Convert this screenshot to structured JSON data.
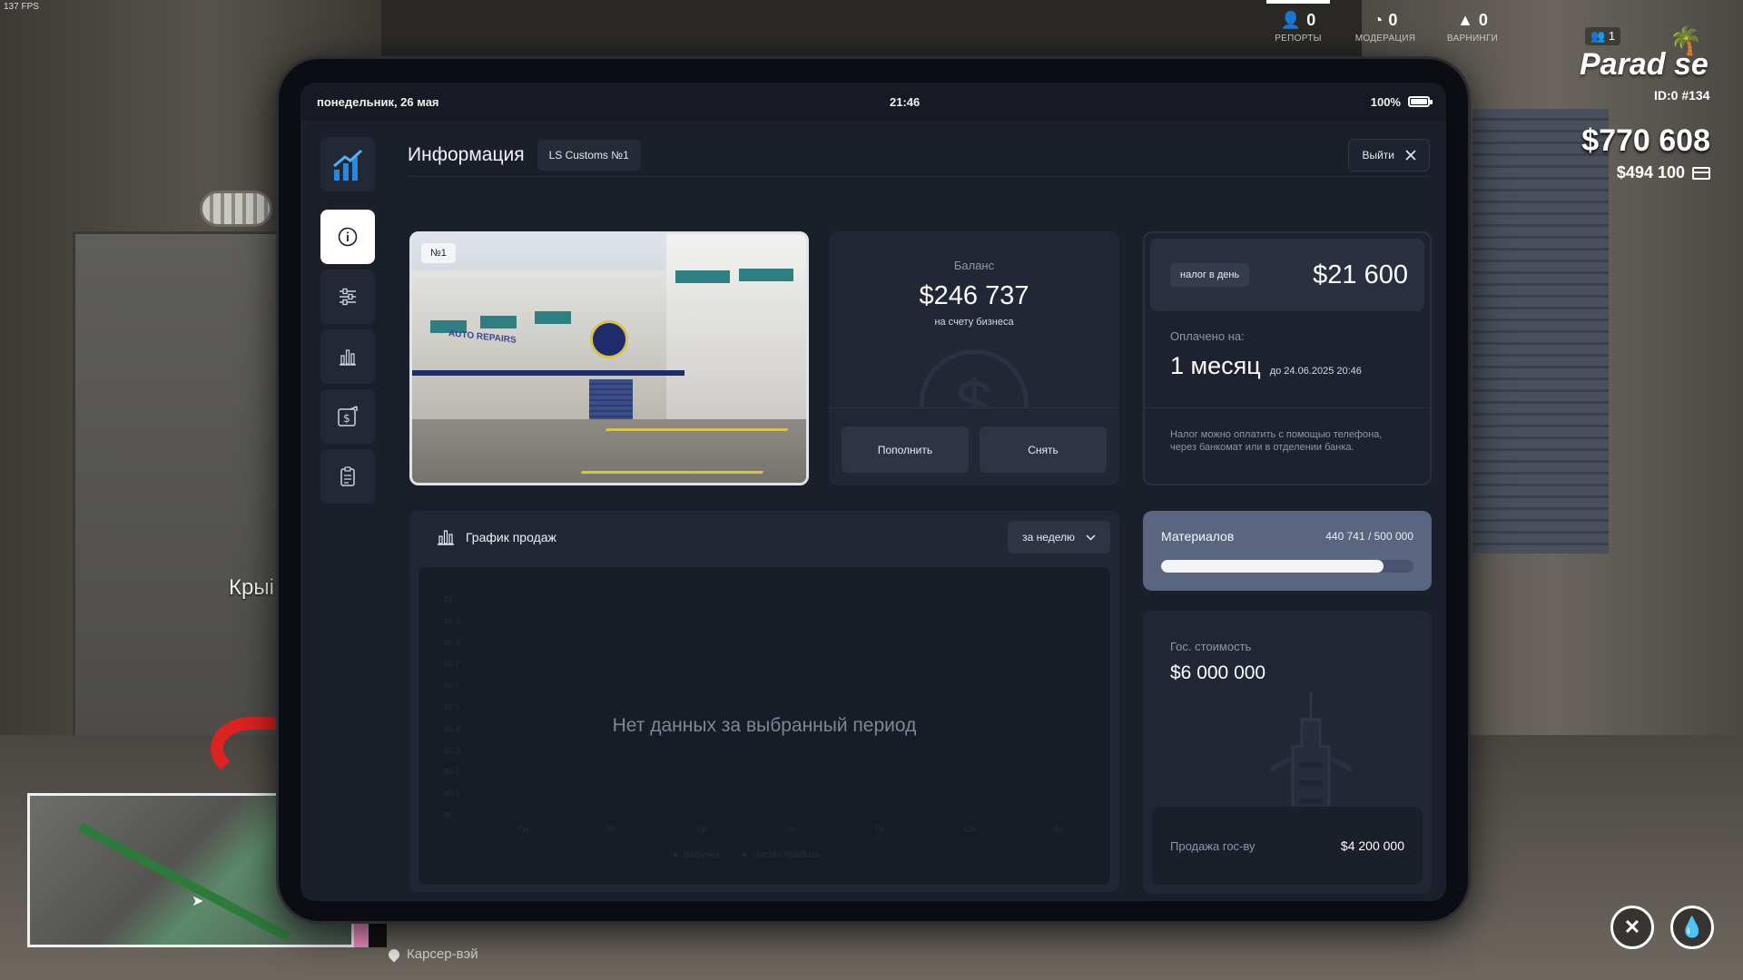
{
  "hud": {
    "fps": "137 FPS",
    "reports": {
      "value": "0",
      "label": "РЕПОРТЫ"
    },
    "moderation": {
      "value": "0",
      "label": "МОДЕРАЦИЯ"
    },
    "warnings": {
      "value": "0",
      "label": "ВАРНИНГИ"
    },
    "online": "1",
    "brand": "Parad se",
    "player_id": "ID:0 #134",
    "cash": "$770 608",
    "bank": "$494 100",
    "side_text": "Крыі",
    "location": "Карсер-вэй"
  },
  "tablet": {
    "date": "понедельник, 26 мая",
    "time": "21:46",
    "battery": "100%"
  },
  "app": {
    "title": "Информация",
    "business_name": "LS Customs №1",
    "exit_label": "Выйти",
    "photo_tag": "№1",
    "photo_sign": "AUTO REPAIRS",
    "balance": {
      "label": "Баланс",
      "amount": "$246 737",
      "sub": "на счету бизнеса",
      "deposit": "Пополнить",
      "withdraw": "Снять"
    },
    "tax": {
      "badge": "налог в день",
      "amount": "$21 600",
      "paid_label": "Оплачено на:",
      "period": "1 месяц",
      "until": "до 24.06.2025 20:46",
      "note": "Налог можно оплатить с помощью телефона, через банкомат или в отделении банка."
    },
    "sales": {
      "title": "График продаж",
      "period": "за неделю",
      "empty": "Нет данных за выбранный период"
    },
    "materials": {
      "title": "Материалов",
      "count": "440 741 / 500 000",
      "fill_fraction": 0.8815
    },
    "gov": {
      "label": "Гос. стоимость",
      "amount": "$6 000 000",
      "sale_label": "Продажа гос-ву",
      "sale_amount": "$4 200 000"
    }
  },
  "chart_data": {
    "type": "line",
    "categories": [
      "Пн",
      "Вт",
      "Ср",
      "Чт",
      "Пт",
      "Сб",
      "Вс"
    ],
    "y_ticks": [
      "$1",
      "$0.9",
      "$0.8",
      "$0.7",
      "$0.6",
      "$0.5",
      "$0.4",
      "$0.3",
      "$0.2",
      "$0.1",
      "$0"
    ],
    "series": [
      {
        "name": "Выручка",
        "values": []
      },
      {
        "name": "Чистая прибыль",
        "values": []
      }
    ],
    "ylim": [
      0,
      1
    ]
  }
}
